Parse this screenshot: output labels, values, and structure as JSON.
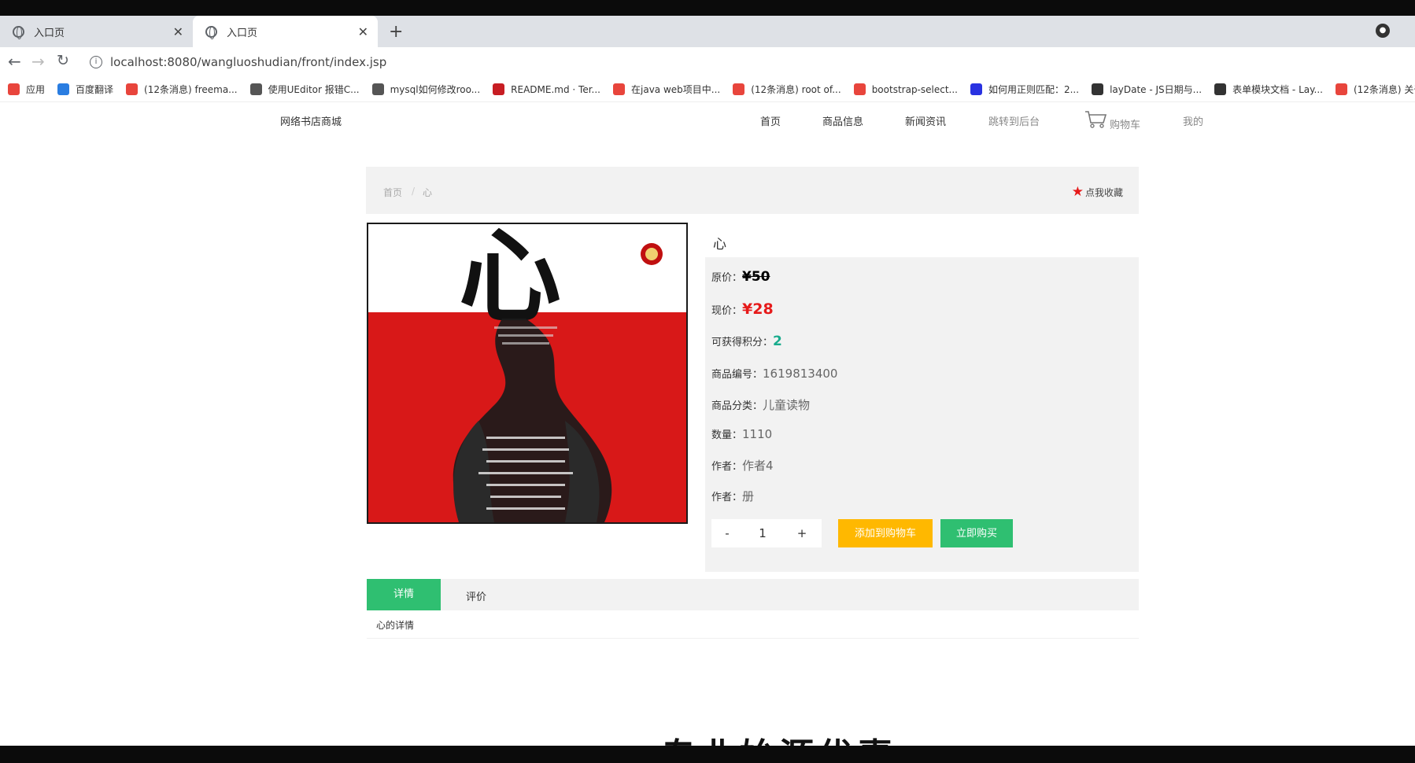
{
  "browser": {
    "tabs": [
      {
        "title": "入口页",
        "active": false
      },
      {
        "title": "入口页",
        "active": true
      }
    ],
    "new_tab": "+",
    "url": "localhost:8080/wangluoshudian/front/index.jsp",
    "bookmarks": [
      {
        "label": "应用",
        "color": "#e8453c"
      },
      {
        "label": "百度翻译",
        "color": "#2a7de1"
      },
      {
        "label": "(12条消息) freema...",
        "color": "#e8453c"
      },
      {
        "label": "使用UEditor 报错C...",
        "color": "#555555"
      },
      {
        "label": "mysql如何修改roo...",
        "color": "#555555"
      },
      {
        "label": "README.md · Ter...",
        "color": "#c71d23"
      },
      {
        "label": "在java web项目中...",
        "color": "#e8453c"
      },
      {
        "label": "(12条消息) root of...",
        "color": "#e8453c"
      },
      {
        "label": "bootstrap-select...",
        "color": "#e8453c"
      },
      {
        "label": "如何用正则匹配：2...",
        "color": "#2932e1"
      },
      {
        "label": "layDate - JS日期与...",
        "color": "#333333"
      },
      {
        "label": "表单模块文档 - Lay...",
        "color": "#333333"
      },
      {
        "label": "(12条消息) 关于la...",
        "color": "#e8453c"
      }
    ]
  },
  "header": {
    "site_title": "网络书店商城",
    "nav": [
      "首页",
      "商品信息",
      "新闻资讯",
      "跳转到后台",
      "购物车",
      "我的"
    ]
  },
  "breadcrumb": {
    "home": "首页",
    "sep": "/",
    "current": "心",
    "favorite": "点我收藏"
  },
  "product": {
    "name": "心",
    "labels": {
      "original_price": "原价：",
      "current_price": "现价：",
      "points": "可获得积分：",
      "code": "商品编号：",
      "category": "商品分类：",
      "quantity": "数量：",
      "author": "作者：",
      "author2": "作者："
    },
    "original_price": "¥50",
    "current_price": "¥28",
    "points": "2",
    "code": "1619813400",
    "category": "儿童读物",
    "quantity": "1110",
    "author": "作者4",
    "author2": "册",
    "cover_title": "心"
  },
  "purchase": {
    "minus": "-",
    "qty": "1",
    "plus": "+",
    "add_to_cart": "添加到购物车",
    "buy_now": "立即购买"
  },
  "tabs": {
    "detail": "详情",
    "review": "评价",
    "detail_text": "心的详情"
  },
  "footer_partial": "专业始源优惠",
  "colors": {
    "accent_green": "#2fbf71",
    "accent_yellow": "#ffb800",
    "price_red": "#e61a1a",
    "points_teal": "#1aac8d"
  }
}
